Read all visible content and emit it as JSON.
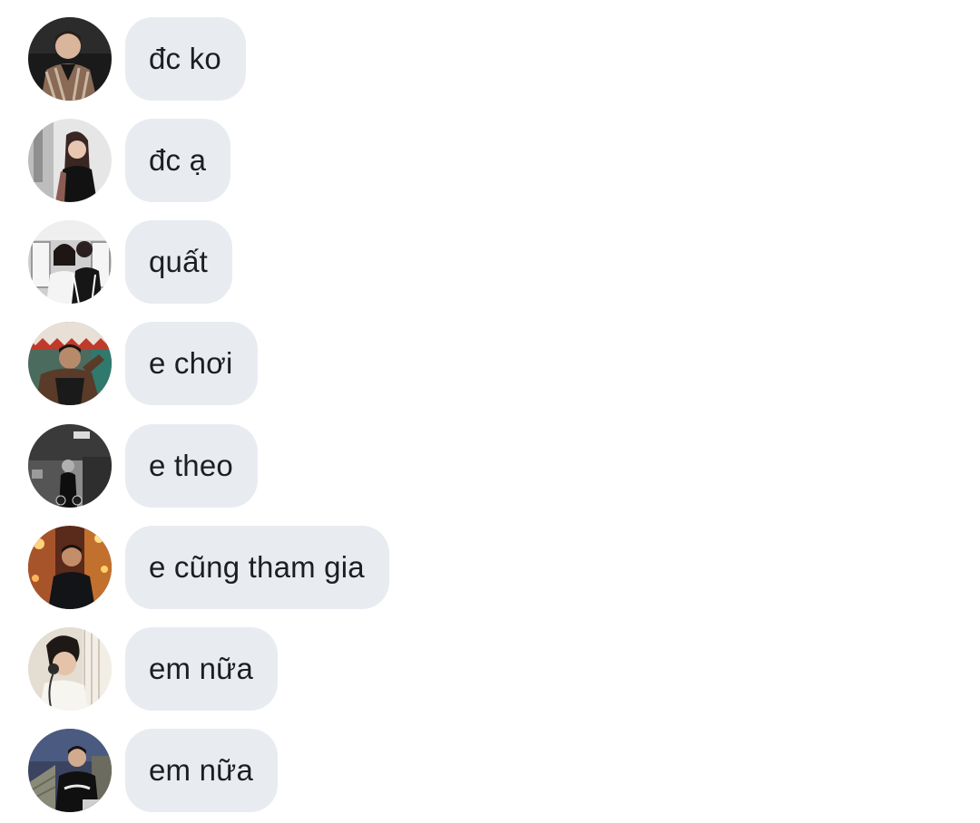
{
  "comments": [
    {
      "avatar_icon": "user-avatar-icon",
      "text": "đc ko"
    },
    {
      "avatar_icon": "user-avatar-icon",
      "text": "đc ạ"
    },
    {
      "avatar_icon": "user-avatar-icon",
      "text": "quất"
    },
    {
      "avatar_icon": "user-avatar-icon",
      "text": "e chơi"
    },
    {
      "avatar_icon": "user-avatar-icon",
      "text": "e theo"
    },
    {
      "avatar_icon": "user-avatar-icon",
      "text": "e cũng tham gia"
    },
    {
      "avatar_icon": "user-avatar-icon",
      "text": "em nữa"
    },
    {
      "avatar_icon": "user-avatar-icon",
      "text": "em nữa"
    }
  ],
  "colors": {
    "bubble_background": "#e8ecf1",
    "text": "#1c1e21",
    "page_background": "#ffffff"
  }
}
